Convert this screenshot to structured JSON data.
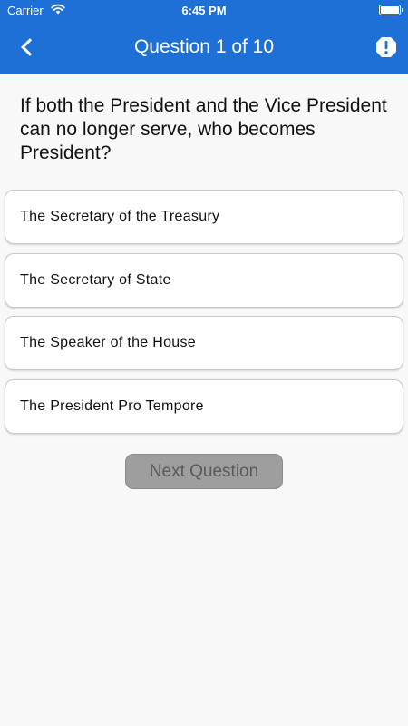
{
  "status_bar": {
    "carrier": "Carrier",
    "time": "6:45 PM"
  },
  "header": {
    "title": "Question 1 of 10",
    "back_icon": "chevron-left-icon",
    "report_icon": "alert-octagon-icon"
  },
  "question": {
    "text": "If both the President and the Vice President can no longer serve, who becomes President?"
  },
  "answers": [
    {
      "label": "The Secretary of the Treasury"
    },
    {
      "label": "The Secretary of State"
    },
    {
      "label": "The Speaker of the House"
    },
    {
      "label": "The President Pro Tempore"
    }
  ],
  "next_button": {
    "label": "Next Question"
  },
  "colors": {
    "header_blue": "#1e6fd6",
    "background": "#f8f8f8",
    "next_disabled": "#9e9e9e"
  }
}
